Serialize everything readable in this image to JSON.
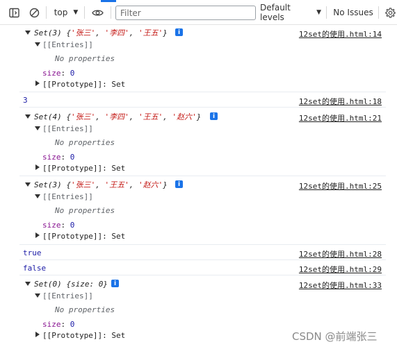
{
  "toolbar": {
    "context": "top",
    "filter_placeholder": "Filter",
    "levels": "Default levels",
    "issues": "No Issues",
    "icons": [
      "sidebar-toggle-icon",
      "clear-console-icon",
      "chevron-down-icon",
      "eye-icon",
      "settings-gear-icon"
    ]
  },
  "messages": [
    {
      "kind": "set",
      "header_prefix": "Set(3) {",
      "items": [
        "'张三'",
        "'李四'",
        "'王五'"
      ],
      "header_suffix": "}",
      "entries_label": "[[Entries]]",
      "no_props": "No properties",
      "size_key": "size",
      "size_value": "0",
      "proto": "[[Prototype]]: Set",
      "source": "12set的使用.html:14"
    },
    {
      "kind": "value",
      "text": "3",
      "source": "12set的使用.html:18"
    },
    {
      "kind": "set",
      "header_prefix": "Set(4) {",
      "items": [
        "'张三'",
        "'李四'",
        "'王五'",
        "'赵六'"
      ],
      "header_suffix": "}",
      "entries_label": "[[Entries]]",
      "no_props": "No properties",
      "size_key": "size",
      "size_value": "0",
      "proto": "[[Prototype]]: Set",
      "source": "12set的使用.html:21"
    },
    {
      "kind": "set",
      "header_prefix": "Set(3) {",
      "items": [
        "'张三'",
        "'王五'",
        "'赵六'"
      ],
      "header_suffix": "}",
      "entries_label": "[[Entries]]",
      "no_props": "No properties",
      "size_key": "size",
      "size_value": "0",
      "proto": "[[Prototype]]: Set",
      "source": "12set的使用.html:25"
    },
    {
      "kind": "value",
      "text": "true",
      "source": "12set的使用.html:28"
    },
    {
      "kind": "value",
      "text": "false",
      "source": "12set的使用.html:29"
    },
    {
      "kind": "set",
      "header_prefix": "Set(0) {size: 0}",
      "items": [],
      "header_suffix": "",
      "entries_label": "[[Entries]]",
      "no_props": "No properties",
      "size_key": "size",
      "size_value": "0",
      "proto": "[[Prototype]]: Set",
      "source": "12set的使用.html:33"
    }
  ],
  "info_glyph": "i",
  "watermark": "CSDN @前端张三"
}
